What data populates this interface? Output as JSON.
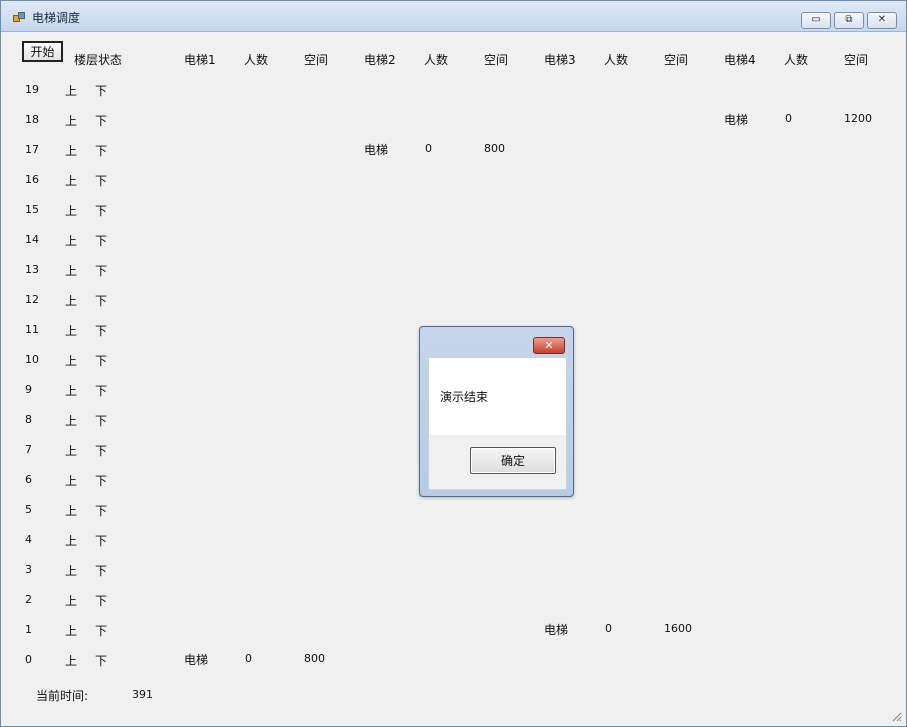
{
  "window": {
    "title": "电梯调度",
    "buttons": {
      "minimize": "▭",
      "maximize": "⧉",
      "close": "✕"
    }
  },
  "toolbar": {
    "start_label": "开始"
  },
  "header": {
    "floor_status": "楼层状态",
    "elevators": [
      {
        "name": "电梯1",
        "people": "人数",
        "space": "空间"
      },
      {
        "name": "电梯2",
        "people": "人数",
        "space": "空间"
      },
      {
        "name": "电梯3",
        "people": "人数",
        "space": "空间"
      },
      {
        "name": "电梯4",
        "people": "人数",
        "space": "空间"
      }
    ]
  },
  "floors": [
    {
      "num": "19",
      "up": "上",
      "down": "下"
    },
    {
      "num": "18",
      "up": "上",
      "down": "下"
    },
    {
      "num": "17",
      "up": "上",
      "down": "下"
    },
    {
      "num": "16",
      "up": "上",
      "down": "下"
    },
    {
      "num": "15",
      "up": "上",
      "down": "下"
    },
    {
      "num": "14",
      "up": "上",
      "down": "下"
    },
    {
      "num": "13",
      "up": "上",
      "down": "下"
    },
    {
      "num": "12",
      "up": "上",
      "down": "下"
    },
    {
      "num": "11",
      "up": "上",
      "down": "下"
    },
    {
      "num": "10",
      "up": "上",
      "down": "下"
    },
    {
      "num": "9",
      "up": "上",
      "down": "下"
    },
    {
      "num": "8",
      "up": "上",
      "down": "下"
    },
    {
      "num": "7",
      "up": "上",
      "down": "下"
    },
    {
      "num": "6",
      "up": "上",
      "down": "下"
    },
    {
      "num": "5",
      "up": "上",
      "down": "下"
    },
    {
      "num": "4",
      "up": "上",
      "down": "下"
    },
    {
      "num": "3",
      "up": "上",
      "down": "下"
    },
    {
      "num": "2",
      "up": "上",
      "down": "下"
    },
    {
      "num": "1",
      "up": "上",
      "down": "下"
    },
    {
      "num": "0",
      "up": "上",
      "down": "下"
    }
  ],
  "elevator_positions": [
    {
      "elevator": 1,
      "floor": "0",
      "label": "电梯",
      "people": "0",
      "space": "800"
    },
    {
      "elevator": 2,
      "floor": "17",
      "label": "电梯",
      "people": "0",
      "space": "800"
    },
    {
      "elevator": 3,
      "floor": "1",
      "label": "电梯",
      "people": "0",
      "space": "1600"
    },
    {
      "elevator": 4,
      "floor": "18",
      "label": "电梯",
      "people": "0",
      "space": "1200"
    }
  ],
  "footer": {
    "time_label": "当前时间:",
    "time_value": "391"
  },
  "dialog": {
    "close": "✕",
    "message": "演示结束",
    "ok_label": "确定"
  }
}
